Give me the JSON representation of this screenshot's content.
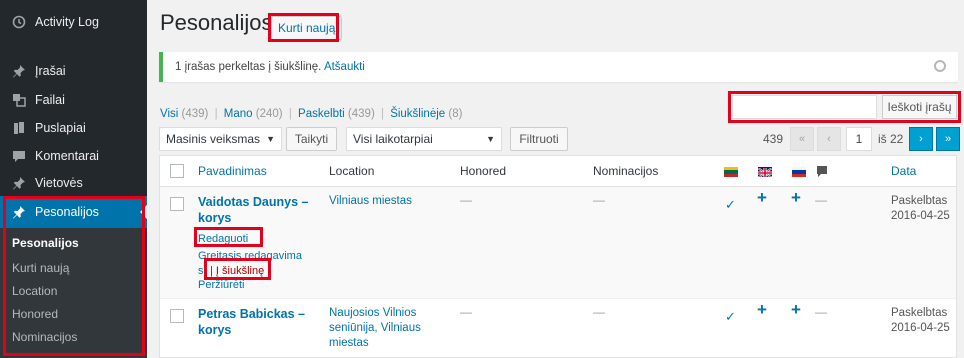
{
  "sidebar": {
    "items": [
      {
        "label": "Activity Log",
        "icon": "clock-icon"
      },
      {
        "label": "Įrašai",
        "icon": "pin-icon"
      },
      {
        "label": "Failai",
        "icon": "media-icon"
      },
      {
        "label": "Puslapiai",
        "icon": "page-icon"
      },
      {
        "label": "Komentarai",
        "icon": "comment-icon"
      },
      {
        "label": "Vietovės",
        "icon": "pin-icon"
      },
      {
        "label": "Pesonalijos",
        "icon": "pin-icon"
      }
    ],
    "submenu": [
      "Pesonalijos",
      "Kurti naują",
      "Location",
      "Honored",
      "Nominacijos"
    ]
  },
  "header": {
    "title": "Pesonalijos",
    "add_new": "Kurti naują"
  },
  "notice": {
    "text": "1 įrašas perkeltas į šiukšlinę.",
    "undo": "Atšaukti"
  },
  "status_links": [
    {
      "label": "Visi",
      "count": "(439)"
    },
    {
      "label": "Mano",
      "count": "(240)"
    },
    {
      "label": "Paskelbti",
      "count": "(439)"
    },
    {
      "label": "Šiukšlinėje",
      "count": "(8)"
    }
  ],
  "search": {
    "value": "",
    "button": "Ieškoti įrašų"
  },
  "toolbar": {
    "bulk": "Masinis veiksmas",
    "apply": "Taikyti",
    "dates": "Visi laikotarpiai",
    "filter": "Filtruoti",
    "total": "439",
    "first": "«",
    "prev": "‹",
    "page": "1",
    "of": "iš 22",
    "next": "›",
    "last": "»"
  },
  "table": {
    "columns": [
      "Pavadinimas",
      "Location",
      "Honored",
      "Nominacijos",
      "Data"
    ],
    "language_flags": [
      "flag-lt-icon",
      "flag-gb-icon",
      "flag-ru-icon",
      "comment-icon"
    ],
    "rows": [
      {
        "title_line1": "Vaidotas Daunys –",
        "title_line2": "korys",
        "location": "Vilniaus miestas",
        "honored": "—",
        "nominations": "—",
        "lang_status": [
          "✓",
          "+",
          "+",
          "—"
        ],
        "status": "Paskelbtas",
        "date": "2016-04-25",
        "actions": {
          "edit": "Redaguoti",
          "quick_edit_1": "Greitasis redagavima",
          "quick_edit_2": "s",
          "trash": "| Į šiukšlinę",
          "view": "Peržiūrėti"
        }
      },
      {
        "title_line1": "Petras Babickas –",
        "title_line2": "korys",
        "location_1": "Naujosios Vilnios",
        "location_2": "seniūnija, Vilniaus",
        "location_3": "miestas",
        "honored": "—",
        "nominations": "—",
        "lang_status": [
          "✓",
          "+",
          "+",
          "—"
        ],
        "status": "Paskelbtas",
        "date": "2016-04-25"
      }
    ]
  },
  "colors": {
    "sidebar": "#23282d",
    "accent": "#0073aa",
    "highlight": "#e2001a",
    "notice": "#46b450"
  }
}
